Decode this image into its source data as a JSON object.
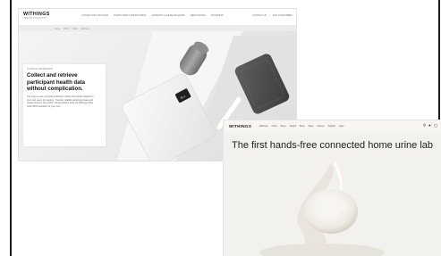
{
  "screenshot1": {
    "brand": "WITHINGS",
    "brand_sub": "HEALTH SOLUTIONS",
    "nav_links": [
      "CONNECTED DEVICES",
      "PARTICIPANT MONITORING",
      "EXPERTS & RESEARCHERS",
      "RESOURCES",
      "BUSINESS"
    ],
    "nav_right": [
      "CONTACT US",
      "FOR CONSUMERS"
    ],
    "sub_links": [
      "Home",
      "RPM",
      "Trials",
      "Wellness"
    ],
    "eyebrow": "CLINICAL RESEARCH",
    "headline": "Collect and retrieve participant health data without complication.",
    "body": "Our easy-to-use connected devices reduce the burden placed on your end users for support. Transfer reliable participant data and measurements into eCRF / decentralized tools via Withings APIs other RPM solutions of your own.",
    "scale_display": "78.2"
  },
  "screenshot2": {
    "brand": "WITHINGS",
    "nav_links": [
      "Wellness",
      "Heart",
      "Sleep",
      "Weight",
      "Body",
      "Shop",
      "Science",
      "Support",
      "Apps"
    ],
    "icons": [
      "search-icon",
      "user-icon",
      "cart-icon"
    ],
    "headline": "The first hands-free connected home urine lab"
  },
  "colors": {
    "frame": "#1b1b1b",
    "hero_bg": "#ececec",
    "shot2_bg": "#f2f1ee"
  }
}
